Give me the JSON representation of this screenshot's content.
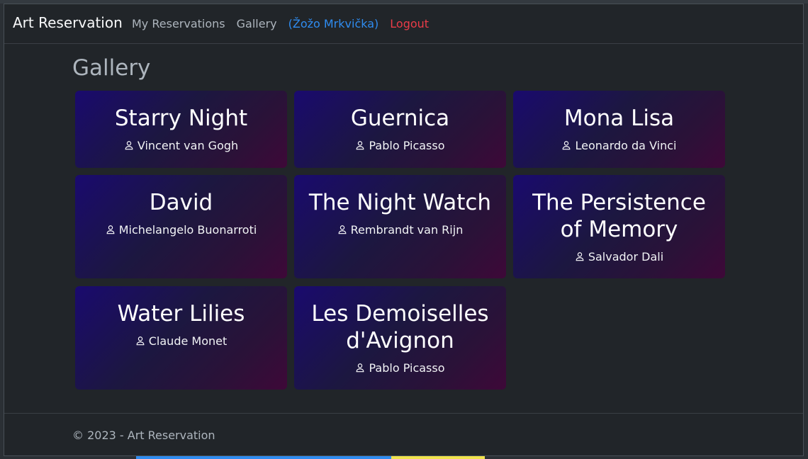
{
  "nav": {
    "brand": "Art Reservation",
    "links": [
      "My Reservations",
      "Gallery"
    ],
    "user": "(Žožo Mrkvička)",
    "logout": "Logout"
  },
  "page": {
    "title": "Gallery"
  },
  "cards": [
    {
      "title": "Starry Night",
      "artist": "Vincent van Gogh"
    },
    {
      "title": "Guernica",
      "artist": "Pablo Picasso"
    },
    {
      "title": "Mona Lisa",
      "artist": "Leonardo da Vinci"
    },
    {
      "title": "David",
      "artist": "Michelangelo Buonarroti"
    },
    {
      "title": "The Night Watch",
      "artist": "Rembrandt van Rijn"
    },
    {
      "title": "The Persistence of Memory",
      "artist": "Salvador Dali"
    },
    {
      "title": "Water Lilies",
      "artist": "Claude Monet"
    },
    {
      "title": "Les Demoiselles d'Avignon",
      "artist": "Pablo Picasso"
    }
  ],
  "footer": {
    "text": "© 2023 - Art Reservation"
  },
  "icons": {
    "artist": "person-icon"
  },
  "colors": {
    "user": "#2f8cf0",
    "logout": "#ea3c48"
  }
}
